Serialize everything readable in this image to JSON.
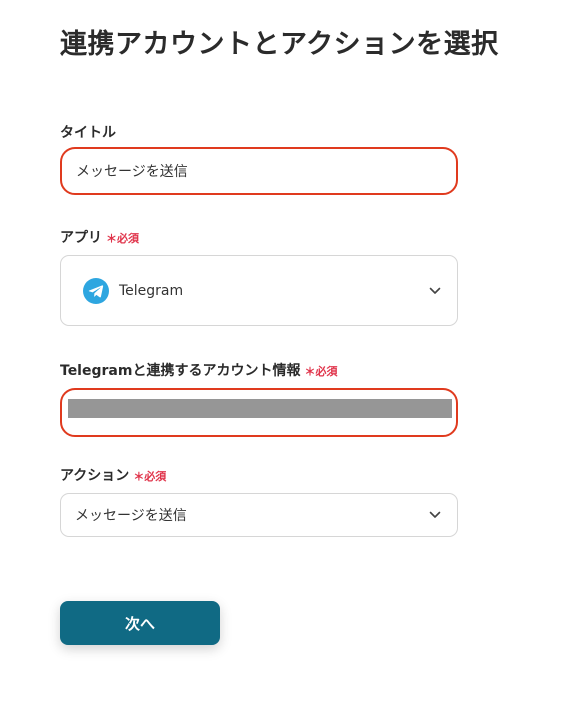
{
  "header": {
    "title": "連携アカウントとアクションを選択"
  },
  "form": {
    "required_label": "＊必須",
    "title_field": {
      "label": "タイトル",
      "value": "メッセージを送信"
    },
    "app_field": {
      "label": "アプリ",
      "value": "Telegram",
      "icon": "telegram-icon"
    },
    "account_field": {
      "label": "Telegramと連携するアカウント情報"
    },
    "action_field": {
      "label": "アクション",
      "value": "メッセージを送信"
    },
    "next_button_label": "次へ"
  },
  "colors": {
    "accent": "#106a84",
    "highlight_border": "#e03a1e",
    "required": "#e0334a",
    "telegram": "#2ea6e0"
  }
}
